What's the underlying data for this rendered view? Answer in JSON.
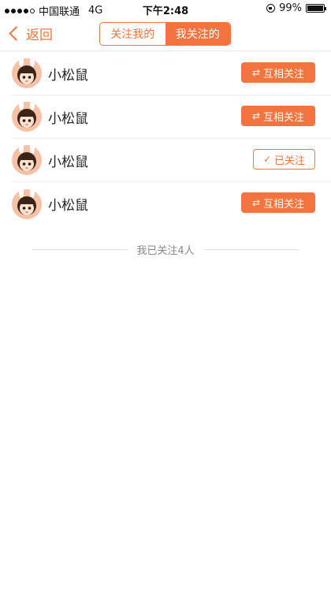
{
  "status_bar": {
    "carrier": "中国联通",
    "network": "4G",
    "time": "下午2:48",
    "battery": "99%",
    "battery_level": 0.99,
    "signal_dots_filled": 4
  },
  "nav": {
    "back_label": "返回",
    "tabs": [
      {
        "label": "关注我的",
        "active": false
      },
      {
        "label": "我关注的",
        "active": true
      }
    ]
  },
  "list": [
    {
      "name": "小松鼠",
      "action_label": "互相关注",
      "action_icon": "⇄",
      "state": "mutual"
    },
    {
      "name": "小松鼠",
      "action_label": "互相关注",
      "action_icon": "⇄",
      "state": "mutual"
    },
    {
      "name": "小松鼠",
      "action_label": "已关注",
      "action_icon": "✓",
      "state": "followed"
    },
    {
      "name": "小松鼠",
      "action_label": "互相关注",
      "action_icon": "⇄",
      "state": "mutual"
    }
  ],
  "footer": {
    "text": "我已关注4人"
  },
  "colors": {
    "accent": "#f47440",
    "divider": "#ececec",
    "muted_text": "#888888"
  }
}
